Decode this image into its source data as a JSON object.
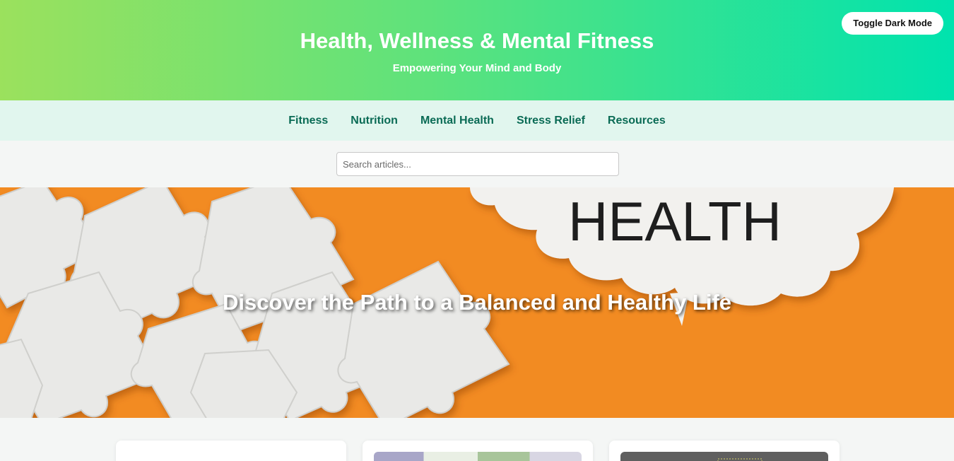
{
  "header": {
    "title": "Health, Wellness & Mental Fitness",
    "subtitle": "Empowering Your Mind and Body",
    "toggle_label": "Toggle Dark Mode"
  },
  "nav": {
    "items": [
      {
        "label": "Fitness"
      },
      {
        "label": "Nutrition"
      },
      {
        "label": "Mental Health"
      },
      {
        "label": "Stress Relief"
      },
      {
        "label": "Resources"
      }
    ]
  },
  "search": {
    "placeholder": "Search articles...",
    "value": ""
  },
  "hero": {
    "title": "Discover the Path to a Balanced and Healthy Life",
    "image_text": "HEALTH",
    "colors": {
      "background": "#f28b22",
      "puzzle": "#e8e8e6",
      "cloud": "#f2f1ee"
    }
  },
  "colors": {
    "header_start": "#9be15d",
    "header_end": "#00e3ae",
    "nav_bg": "#e1f6ee",
    "nav_text": "#0a6b55"
  }
}
